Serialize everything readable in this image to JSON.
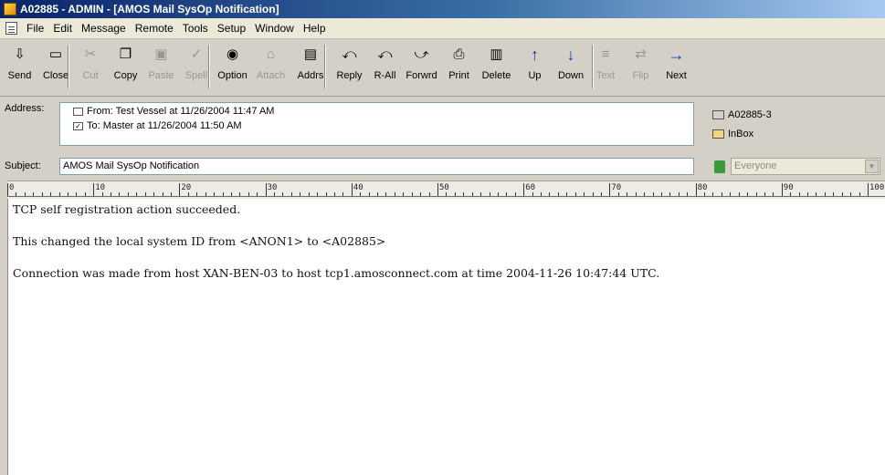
{
  "window": {
    "title": "A02885 - ADMIN - [AMOS Mail SysOp Notification]"
  },
  "menu": [
    "File",
    "Edit",
    "Message",
    "Remote",
    "Tools",
    "Setup",
    "Window",
    "Help"
  ],
  "toolbar": [
    {
      "label": "Send",
      "icon": "send-icon",
      "enabled": true
    },
    {
      "label": "Close",
      "icon": "close-icon",
      "enabled": true
    },
    {
      "label": "Cut",
      "icon": "scissors-icon",
      "enabled": false
    },
    {
      "label": "Copy",
      "icon": "copy-icon",
      "enabled": true
    },
    {
      "label": "Paste",
      "icon": "paste-icon",
      "enabled": false
    },
    {
      "label": "Spell",
      "icon": "spell-icon",
      "enabled": false
    },
    {
      "label": "Option",
      "icon": "option-icon",
      "enabled": true
    },
    {
      "label": "Attach",
      "icon": "attach-icon",
      "enabled": false
    },
    {
      "label": "Addrs",
      "icon": "address-book-icon",
      "enabled": true
    },
    {
      "label": "Reply",
      "icon": "reply-icon",
      "enabled": true
    },
    {
      "label": "R-All",
      "icon": "reply-all-icon",
      "enabled": true
    },
    {
      "label": "Forwrd",
      "icon": "forward-icon",
      "enabled": true
    },
    {
      "label": "Print",
      "icon": "printer-icon",
      "enabled": true
    },
    {
      "label": "Delete",
      "icon": "trash-icon",
      "enabled": true
    },
    {
      "label": "Up",
      "icon": "arrow-up-icon",
      "enabled": true
    },
    {
      "label": "Down",
      "icon": "arrow-down-icon",
      "enabled": true
    },
    {
      "label": "Text",
      "icon": "text-icon",
      "enabled": false
    },
    {
      "label": "Flip",
      "icon": "flip-icon",
      "enabled": false
    },
    {
      "label": "Next",
      "icon": "next-icon",
      "enabled": true
    }
  ],
  "header": {
    "address_label": "Address:",
    "from_line": "From: Test Vessel at 11/26/2004 11:47 AM",
    "to_line": "To: Master at 11/26/2004 11:50 AM",
    "message_id": "A02885-3",
    "folder": "InBox",
    "subject_label": "Subject:",
    "subject_value": "AMOS Mail SysOp Notification",
    "visibility": "Everyone"
  },
  "ruler": [
    "0",
    "10",
    "20",
    "30",
    "40",
    "50",
    "60",
    "70",
    "80",
    "90",
    "100"
  ],
  "message_body": [
    "TCP self registration action succeeded.",
    "This changed the local system ID from <ANON1> to <A02885>",
    "Connection was made from host XAN-BEN-03 to host tcp1.amosconnect.com at time 2004-11-26 10:47:44 UTC."
  ]
}
